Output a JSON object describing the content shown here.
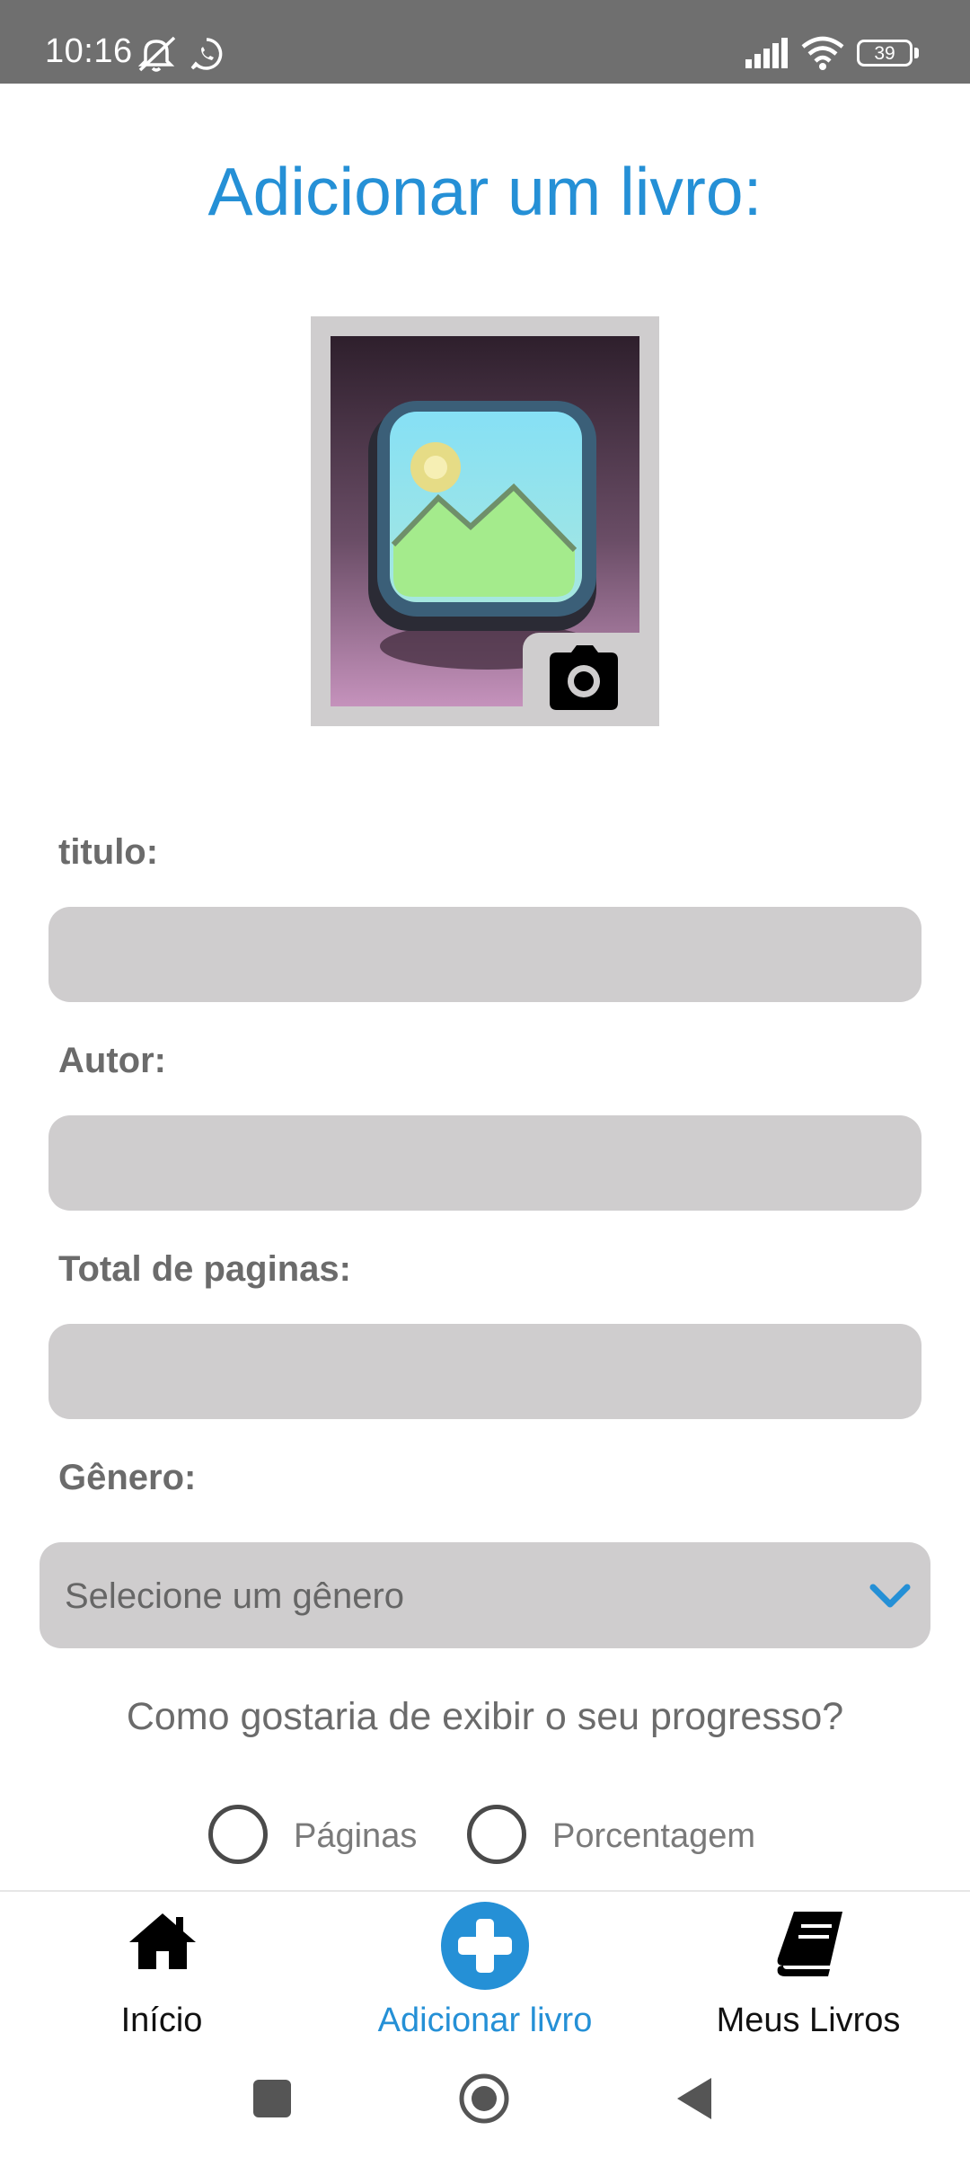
{
  "status_bar": {
    "time": "10:16",
    "battery": "39",
    "icons": [
      "mute-icon",
      "whatsapp-icon",
      "signal-icon",
      "wifi-icon",
      "battery-icon"
    ]
  },
  "page": {
    "title": "Adicionar um livro:"
  },
  "image_picker": {
    "placeholder_icon": "image-placeholder-icon",
    "camera_icon": "camera-icon"
  },
  "form": {
    "title_label": "titulo:",
    "title_value": "",
    "author_label": "Autor:",
    "author_value": "",
    "pages_label": "Total de paginas:",
    "pages_value": "",
    "genre_label": "Gênero:",
    "genre_placeholder": "Selecione um gênero",
    "progress_question": "Como gostaria de exibir o seu progresso?",
    "progress_options": [
      {
        "label": "Páginas",
        "selected": false
      },
      {
        "label": "Porcentagem",
        "selected": false
      }
    ]
  },
  "bottom_nav": {
    "items": [
      {
        "label": "Início",
        "icon": "home-icon",
        "active": false
      },
      {
        "label": "Adicionar livro",
        "icon": "plus-circle-icon",
        "active": true
      },
      {
        "label": "Meus Livros",
        "icon": "book-icon",
        "active": false
      }
    ]
  },
  "colors": {
    "accent": "#2590d6",
    "status_bar": "#6f6f6f",
    "input_bg": "#cfcdce",
    "label": "#6b6b6b"
  }
}
